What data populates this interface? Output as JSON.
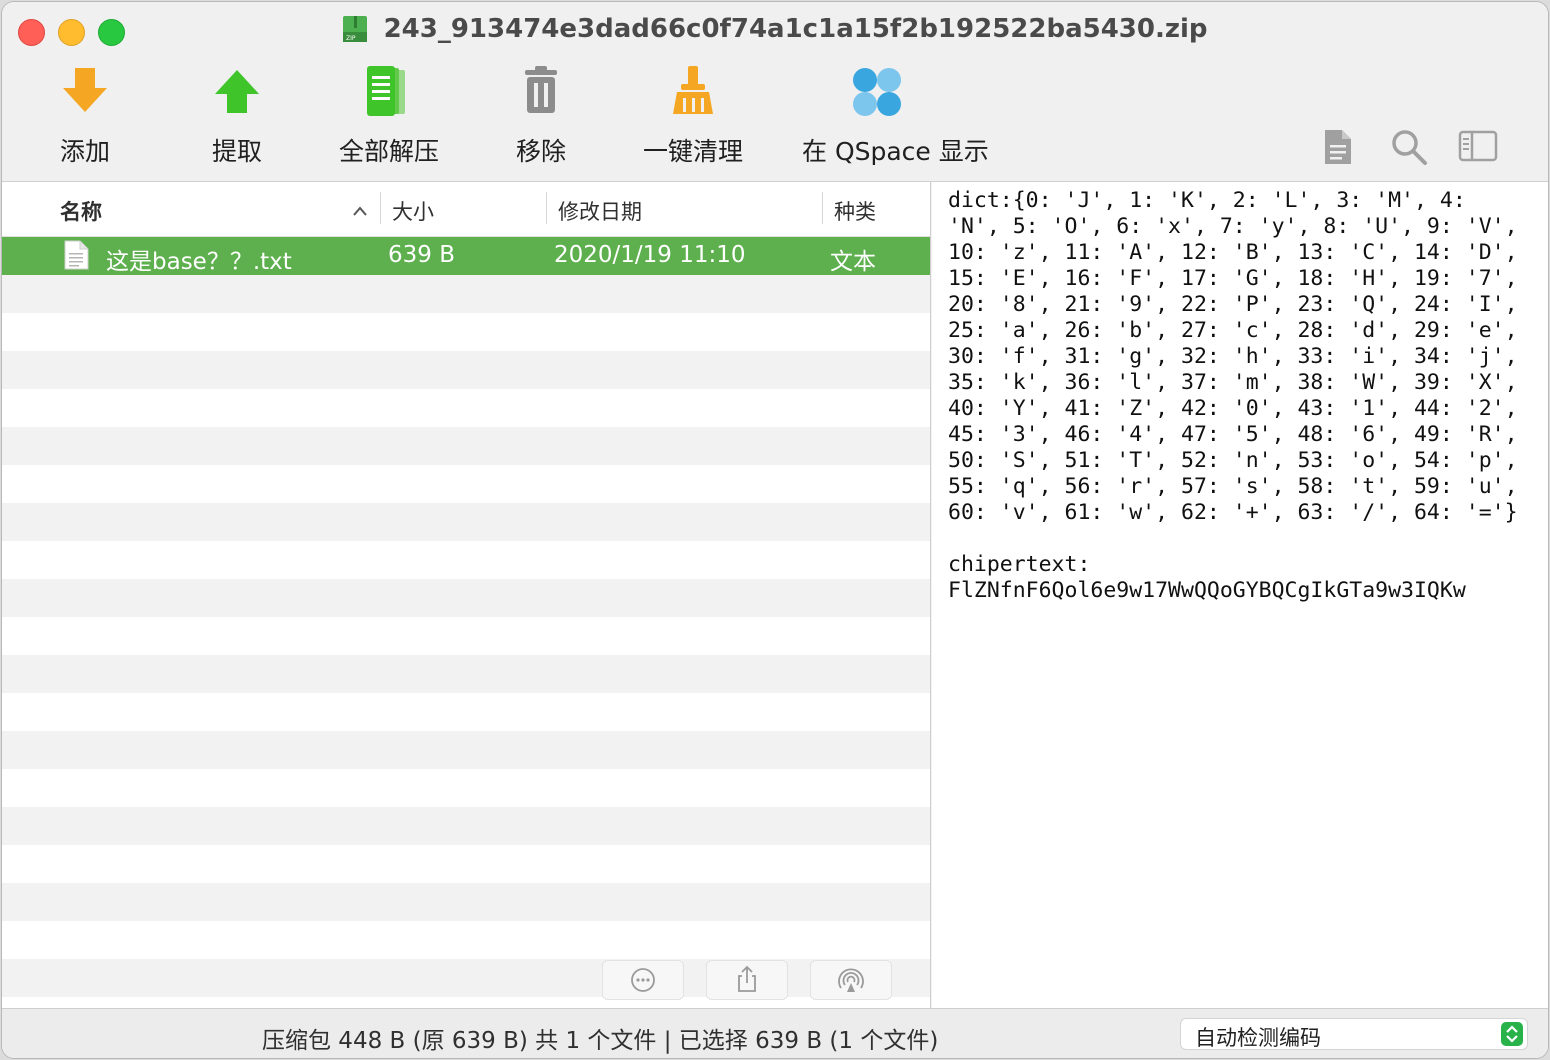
{
  "window": {
    "title": "243_913474e3dad66c0f74a1c1a15f2b192522ba5430.zip"
  },
  "toolbar": {
    "items": [
      {
        "label": "添加",
        "icon": "add-arrow-down-icon",
        "color": "#f5a623"
      },
      {
        "label": "提取",
        "icon": "extract-arrow-up-icon",
        "color": "#3fc42a"
      },
      {
        "label": "全部解压",
        "icon": "extract-all-icon",
        "color": "#3fc42a"
      },
      {
        "label": "移除",
        "icon": "trash-icon",
        "color": "#8c8c8c"
      },
      {
        "label": "一键清理",
        "icon": "broom-icon",
        "color": "#f5a623"
      },
      {
        "label": "在 QSpace 显示",
        "icon": "qspace-icon",
        "color": "#39a6e0"
      }
    ],
    "right_icons": [
      "document-icon",
      "search-icon",
      "sidebar-icon"
    ]
  },
  "list": {
    "columns": {
      "name": "名称",
      "size": "大小",
      "modified": "修改日期",
      "kind": "种类"
    },
    "files": [
      {
        "name": "这是base？？.txt",
        "size": "639 B",
        "modified": "2020/1/19 11:10",
        "kind": "文本",
        "selected": true
      }
    ],
    "bottom_buttons": [
      "more-icon",
      "share-icon",
      "airdrop-icon"
    ]
  },
  "preview": {
    "text": "dict:{0: 'J', 1: 'K', 2: 'L', 3: 'M', 4:\n'N', 5: 'O', 6: 'x', 7: 'y', 8: 'U', 9: 'V',\n10: 'z', 11: 'A', 12: 'B', 13: 'C', 14: 'D',\n15: 'E', 16: 'F', 17: 'G', 18: 'H', 19: '7',\n20: '8', 21: '9', 22: 'P', 23: 'Q', 24: 'I',\n25: 'a', 26: 'b', 27: 'c', 28: 'd', 29: 'e',\n30: 'f', 31: 'g', 32: 'h', 33: 'i', 34: 'j',\n35: 'k', 36: 'l', 37: 'm', 38: 'W', 39: 'X',\n40: 'Y', 41: 'Z', 42: '0', 43: '1', 44: '2',\n45: '3', 46: '4', 47: '5', 48: '6', 49: 'R',\n50: 'S', 51: 'T', 52: 'n', 53: 'o', 54: 'p',\n55: 'q', 56: 'r', 57: 's', 58: 't', 59: 'u',\n60: 'v', 61: 'w', 62: '+', 63: '/', 64: '='}\n\nchipertext:\nFlZNfnF6Qol6e9w17WwQQoGYBQCgIkGTa9w3IQKw"
  },
  "status": {
    "summary": "压缩包 448 B (原 639 B) 共 1 个文件  |  已选择 639 B (1 个文件)",
    "encoding": "自动检测编码"
  }
}
